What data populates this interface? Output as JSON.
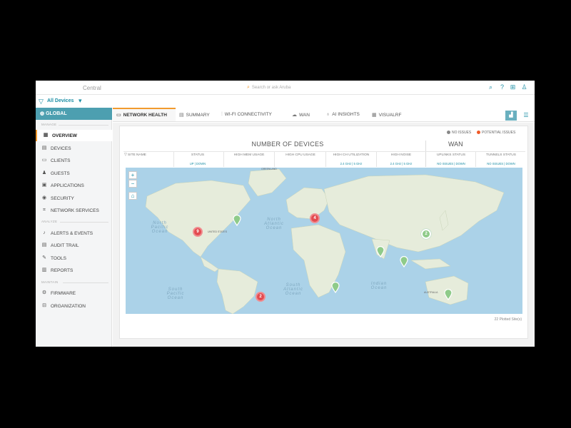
{
  "app": {
    "brand": "Central",
    "search_placeholder": "Search or ask Aruba"
  },
  "filter": {
    "label": "All Devices"
  },
  "sidebar": {
    "global_label": "GLOBAL",
    "sections": [
      {
        "label": "MANAGE",
        "items": [
          "OVERVIEW",
          "DEVICES",
          "CLIENTS",
          "GUESTS",
          "APPLICATIONS",
          "SECURITY",
          "NETWORK SERVICES"
        ]
      },
      {
        "label": "ANALYZE",
        "items": [
          "ALERTS & EVENTS",
          "AUDIT TRAIL",
          "TOOLS",
          "REPORTS"
        ]
      },
      {
        "label": "MAINTAIN",
        "items": [
          "FIRMWARE",
          "ORGANIZATION"
        ]
      }
    ],
    "active_item": "OVERVIEW"
  },
  "tabs": [
    "NETWORK HEALTH",
    "SUMMARY",
    "WI-FI CONNECTIVITY",
    "WAN",
    "AI INSIGHTS",
    "VISUALRF"
  ],
  "active_tab": "NETWORK HEALTH",
  "card": {
    "legend_no_issues": "NO ISSUES",
    "legend_potential": "POTENTIAL ISSUES",
    "heading_devices": "NUMBER OF DEVICES",
    "heading_wan": "WAN",
    "columns": [
      {
        "label": "SITE NAME",
        "sub": ""
      },
      {
        "label": "STATUS",
        "sub": "UP | DOWN"
      },
      {
        "label": "HIGH MEM USAGE",
        "sub": ""
      },
      {
        "label": "HIGH CPU USAGE",
        "sub": ""
      },
      {
        "label": "HIGH CH UTILIZATION",
        "sub": "2.4 GHz | 5 GHz"
      },
      {
        "label": "HIGH NOISE",
        "sub": "2.4 GHz | 5 GHz"
      },
      {
        "label": "UPLINKS STATUS",
        "sub": "NO ISSUES | DOWN"
      },
      {
        "label": "TUNNELS STATUS",
        "sub": "NO ISSUES | DOWN"
      }
    ],
    "map": {
      "oceans": [
        "North Pacific Ocean",
        "North Atlantic Ocean",
        "South Pacific Ocean",
        "South Atlantic Ocean",
        "Indian Ocean"
      ],
      "markers": [
        {
          "kind": "red",
          "count": "9"
        },
        {
          "kind": "red",
          "count": "4"
        },
        {
          "kind": "red",
          "count": "2"
        },
        {
          "kind": "green",
          "count": "2"
        }
      ],
      "labels": [
        "GREENLAND",
        "UNITED STATES",
        "AUSTRALIA"
      ]
    },
    "plotted": "22 Plotted Site(s)"
  },
  "colors": {
    "accent": "#1b8ea5",
    "active_tab_border": "#f29a2e",
    "issue_red": "#e34b50",
    "ok_green": "#8fcb8a"
  }
}
